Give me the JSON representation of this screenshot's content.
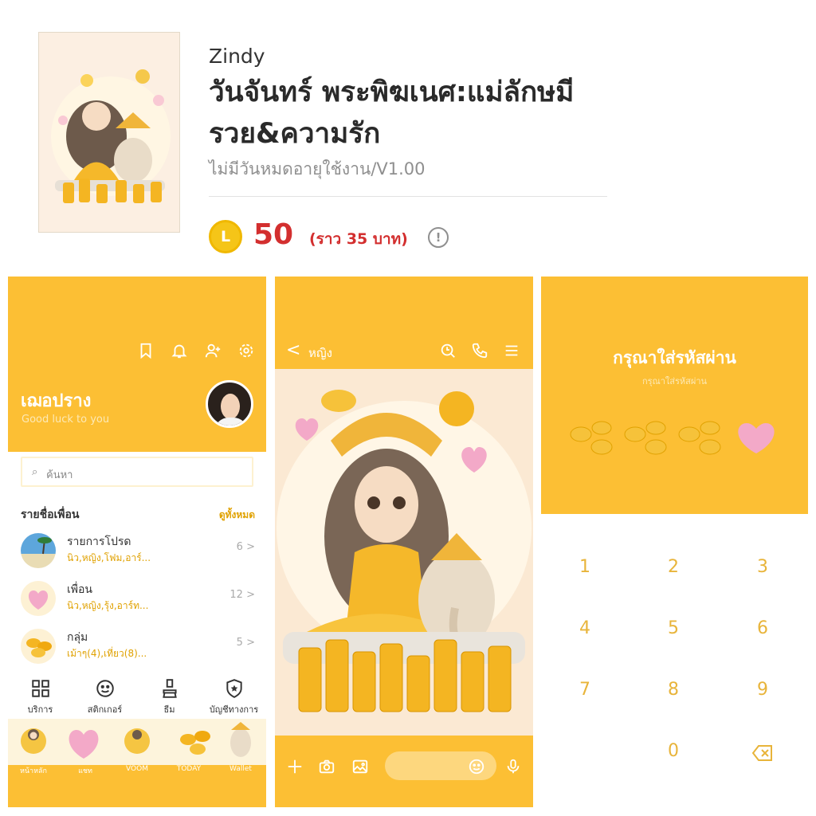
{
  "product": {
    "author": "Zindy",
    "title": "วันจันทร์ พระพิฆเนศ:แม่ลักษมี รวย&ความรัก",
    "subtitle": "ไม่มีวันหมดอายุใช้งาน/V1.00",
    "coin_symbol": "L",
    "price": "50",
    "approx_price": "(ราว  35 บาท)",
    "info_symbol": "!",
    "accent_color": "#fcbf34",
    "price_color": "#d32f2f"
  },
  "home_screen": {
    "header_icons": [
      "bookmark-icon",
      "bell-icon",
      "add-friend-icon",
      "settings-icon"
    ],
    "username": "เฌอปราง",
    "status_message": "Good luck to you",
    "search_placeholder": "ค้นหา",
    "section_title": "รายชื่อเพื่อน",
    "see_all": "ดูทั้งหมด",
    "rows": [
      {
        "name": "รายการโปรด",
        "sub": "นิว,หญิง,โฟม,อาร์...",
        "count": "6",
        "chevron": ">"
      },
      {
        "name": "เพื่อน",
        "sub": "นิว,หญิง,รุ้ง,อาร์ท...",
        "count": "12",
        "chevron": ">"
      },
      {
        "name": "กลุ่ม",
        "sub": "เม้าๆ(4),เที่ยว(8)...",
        "count": "5",
        "chevron": ">"
      }
    ],
    "menu": [
      {
        "label": "บริการ",
        "icon": "grid-icon"
      },
      {
        "label": "สติกเกอร์",
        "icon": "smiley-icon"
      },
      {
        "label": "ธีม",
        "icon": "brush-icon"
      },
      {
        "label": "บัญชีทางการ",
        "icon": "shield-star-icon"
      }
    ],
    "tabs": [
      "หน้าหลัก",
      "แชท",
      "VOOM",
      "TODAY",
      "Wallet"
    ]
  },
  "chat_screen": {
    "back_symbol": "<",
    "chat_name": "หญิง",
    "header_icons": [
      "search-icon",
      "phone-icon",
      "menu-icon"
    ],
    "input_icons": [
      "plus-icon",
      "camera-icon",
      "image-icon",
      "emoji-icon",
      "mic-icon"
    ]
  },
  "passcode_screen": {
    "title": "กรุณาใส่รหัสผ่าน",
    "subtitle": "กรุณาใส่รหัสผ่าน",
    "keys": [
      "1",
      "2",
      "3",
      "4",
      "5",
      "6",
      "7",
      "8",
      "9",
      "0"
    ],
    "delete_icon": "backspace-icon"
  }
}
